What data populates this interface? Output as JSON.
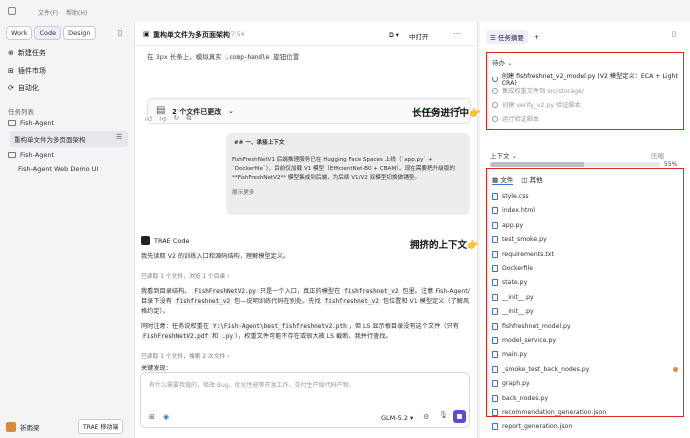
{
  "menu": [
    "文件(F)",
    "帮助(H)"
  ],
  "mode_tabs": [
    "Work",
    "Code",
    "Design"
  ],
  "sidebar": {
    "nav": [
      "新建任务",
      "插件市场",
      "自动化"
    ],
    "task_list_label": "任务列表",
    "groups": [
      {
        "name": "Fish-Agent",
        "items": [
          "重构单文件为多页面架构"
        ]
      },
      {
        "name": "Fish-Agent",
        "items": [
          "Fish-Agent Web Demo UI"
        ]
      }
    ],
    "user_name": "祈雨梁",
    "mobile_badge": "TRAE 移动端"
  },
  "main": {
    "title": "重构单文件为多页面架构",
    "time": "17:54",
    "open_label": "中打开",
    "hint_pre": "在 3px 长条上，模拟真实",
    "hint_code": ".comp-handle",
    "hint_post": "旋钮位置",
    "changes_label": "2 个文件已更改",
    "added": "+192",
    "removed": "-31",
    "user_msg_title": "## 一、承接上下文",
    "user_msg_body": "FishFreshNetV1 后端推理服务已在 Hugging Face Spaces 上线（`app.py` + `Dockerfile`），目前仅加载 V1 模型（EfficientNet-B0 + CBAM）。现在需要把升级版的 **FishFreshNetV2** 模型集成到后端，为后续 V1/V2 双模型切换做铺垫。",
    "show_more": "展示更多",
    "agent_name": "TRAE Code",
    "ai_line1": "我先读取 V2 的训练入口和源码结构，理解模型定义。",
    "tool1": "已读取 1 个文件，浏览 1 个目录",
    "ai_para2_pre": "我看到目录结构。",
    "ai_para2_c1": "FishFreshNetV2.py",
    "ai_para2_mid": "只是一个入口，真正的模型在",
    "ai_para2_c2": "fishfreshnet_v2",
    "ai_para2_mid2": "包里。注意 Fish-Agent/ 目录下没有",
    "ai_para2_c3": "fishfreshnet_v2",
    "ai_para2_mid3": "包—说明训练代码在别处。先找",
    "ai_para2_c4": "fishfreshnet_v2",
    "ai_para2_end": "包位置和 V1 模型定义（了解风格约定）。",
    "ai_para3_pre": "同时注意：任务说权重在",
    "ai_para3_c1": "Y:\\Fish-Agent\\best_fishfreshnetv2.pth",
    "ai_para3_mid": "，但 LS 显示根目录没有这个文件（只有",
    "ai_para3_c2": "FishFreshNetV2.pdf",
    "ai_para3_mid2": "和",
    "ai_para3_c3": ".py",
    "ai_para3_end": "），权重文件可能不存在或很大被 LS 截断。我并行查找。",
    "tool2": "已读取 1 个文件，搜索 2 次文件",
    "ai_cut": "关键发现：",
    "input_placeholder": "有什么需要我做的，修改 Bug、优化性能等开发工作，交付生产级代码产物。",
    "model_name": "GLM-5.2"
  },
  "right": {
    "tab_summary": "任务摘要",
    "todo_label": "待办",
    "tasks": [
      {
        "text": "创建 fishfreshnet_v2_model.py (V2 模型定义：ECA + Light CRA)",
        "state": "running"
      },
      {
        "text": "集成权重文件到 src/storage/",
        "state": "pending"
      },
      {
        "text": "创建 verify_v2.py 验证脚本",
        "state": "pending"
      },
      {
        "text": "运行验证脚本",
        "state": "pending"
      }
    ],
    "context_label": "上下文",
    "compress_label": "压缩",
    "context_percent": 55,
    "context_percent_text": "55%",
    "tab_files": "文件",
    "tab_other": "其他",
    "files": [
      "style.css",
      "index.html",
      "app.py",
      "test_smoke.py",
      "requirements.txt",
      "Dockerfile",
      "state.py",
      "__init__.py",
      "__init__.py",
      "fishfreshnet_model.py",
      "model_service.py",
      "main.py",
      "_smoke_test_back_nodes.py",
      "graph.py",
      "back_nodes.py",
      "recommendation_generation.json",
      "report_generation.json"
    ]
  },
  "annotations": {
    "long_task": "长任务进行中👉",
    "crowded_context": "拥挤的上下文👉"
  },
  "colors": {
    "accent": "#3a6fd8",
    "annotation_box": "#e2261f",
    "send_button": "#5b4dd6"
  }
}
